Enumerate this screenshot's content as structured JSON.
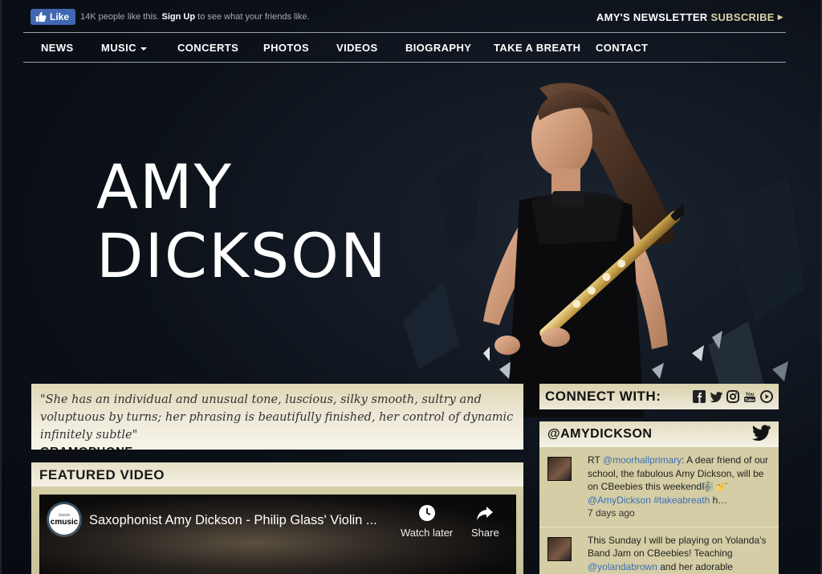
{
  "facebook": {
    "like_label": "Like",
    "count_text": "14K people like this.",
    "signup_label": "Sign Up",
    "signup_suffix": "to see what your friends like."
  },
  "newsletter": {
    "label": "AMY'S NEWSLETTER",
    "subscribe_label": "SUBSCRIBE"
  },
  "nav": {
    "items": [
      {
        "label": "NEWS"
      },
      {
        "label": "MUSIC"
      },
      {
        "label": "CONCERTS"
      },
      {
        "label": "PHOTOS"
      },
      {
        "label": "VIDEOS"
      },
      {
        "label": "BIOGRAPHY"
      },
      {
        "label": "TAKE A BREATH"
      },
      {
        "label": "CONTACT"
      }
    ]
  },
  "hero": {
    "first_name": "AMY",
    "last_name": "DICKSON"
  },
  "quote": {
    "text": "\"She has an individual and unusual tone, luscious, silky smooth, sultry and voluptuous by turns; her phrasing is beautifully finished, her control of dynamic infinitely subtle\"",
    "source": "GRAMOPHONE"
  },
  "featured_video": {
    "heading": "FEATURED VIDEO",
    "logo_small": "classic",
    "logo_big": "cmusic",
    "title": "Saxophonist Amy Dickson - Philip Glass' Violin ...",
    "watch_later_label": "Watch later",
    "share_label": "Share"
  },
  "connect": {
    "label": "CONNECT WITH:",
    "icons": [
      "facebook-icon",
      "twitter-icon",
      "instagram-icon",
      "youtube-icon",
      "play-icon"
    ]
  },
  "twitter": {
    "handle": "@AMYDICKSON",
    "tweets": [
      {
        "prefix": "RT ",
        "mention": "@moorhallprimary",
        "text": ": A dear friend of our school, the fabulous Amy Dickson, will be on CBeebies this weekend🎼 🎷",
        "mention2": "@AmyDickson",
        "hashtag": " #takeabreath",
        "suffix": " h…",
        "time": "7 days ago"
      },
      {
        "text": "This Sunday I will be playing on Yolanda's Band Jam on CBeebies! Teaching",
        "mention": "@yolandabrown",
        "suffix": " and her adorable audience"
      }
    ]
  }
}
